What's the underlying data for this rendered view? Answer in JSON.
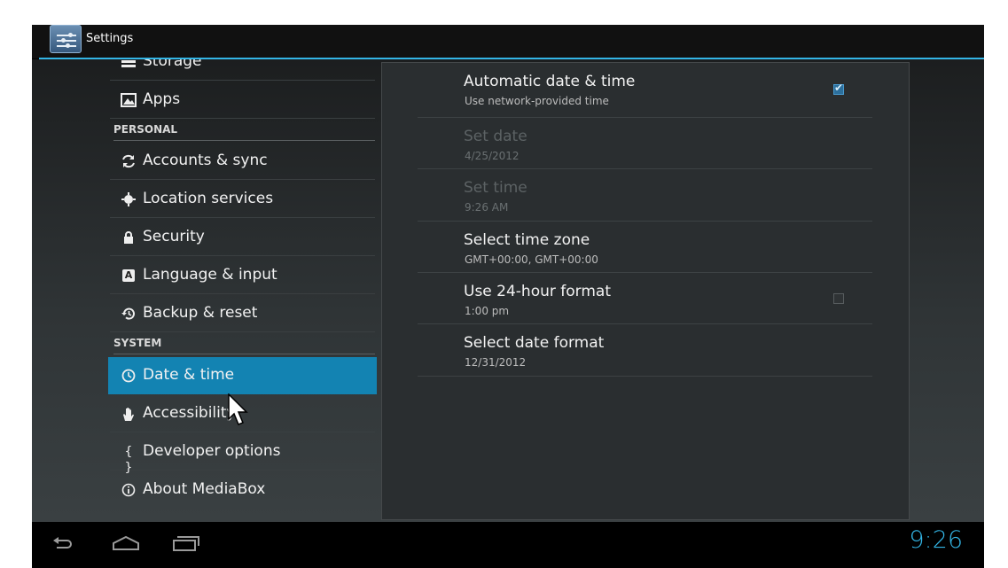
{
  "action_bar": {
    "title": "Settings"
  },
  "left_menu": {
    "items_top": [
      {
        "label": "Storage",
        "icon": "storage-icon"
      },
      {
        "label": "Apps",
        "icon": "apps-icon"
      }
    ],
    "personal_header": "PERSONAL",
    "personal_items": [
      {
        "label": "Accounts & sync",
        "icon": "sync-icon"
      },
      {
        "label": "Location services",
        "icon": "location-icon"
      },
      {
        "label": "Security",
        "icon": "lock-icon"
      },
      {
        "label": "Language & input",
        "icon": "language-icon"
      },
      {
        "label": "Backup & reset",
        "icon": "backup-icon"
      }
    ],
    "system_header": "SYSTEM",
    "system_items": [
      {
        "label": "Date & time",
        "icon": "clock-icon",
        "selected": true
      },
      {
        "label": "Accessibility",
        "icon": "hand-icon"
      },
      {
        "label": "Developer options",
        "icon": "braces-icon"
      },
      {
        "label": "About MediaBox",
        "icon": "info-icon"
      }
    ]
  },
  "date_time": {
    "prefs": [
      {
        "title": "Automatic date & time",
        "summary": "Use network-provided time",
        "checkbox": true,
        "checked": true,
        "enabled": true
      },
      {
        "title": "Set date",
        "summary": "4/25/2012",
        "enabled": false
      },
      {
        "title": "Set time",
        "summary": "9:26 AM",
        "enabled": false
      },
      {
        "title": "Select time zone",
        "summary": "GMT+00:00, GMT+00:00",
        "enabled": true
      },
      {
        "title": "Use 24-hour format",
        "summary": "1:00 pm",
        "checkbox": true,
        "checked": false,
        "enabled": true
      },
      {
        "title": "Select date format",
        "summary": "12/31/2012",
        "enabled": true
      }
    ]
  },
  "nav_bar": {
    "buttons": [
      "back-icon",
      "home-icon",
      "recent-apps-icon"
    ],
    "clock": "9:26"
  },
  "colors": {
    "accent": "#33b5e5",
    "selected": "#1383b2"
  }
}
